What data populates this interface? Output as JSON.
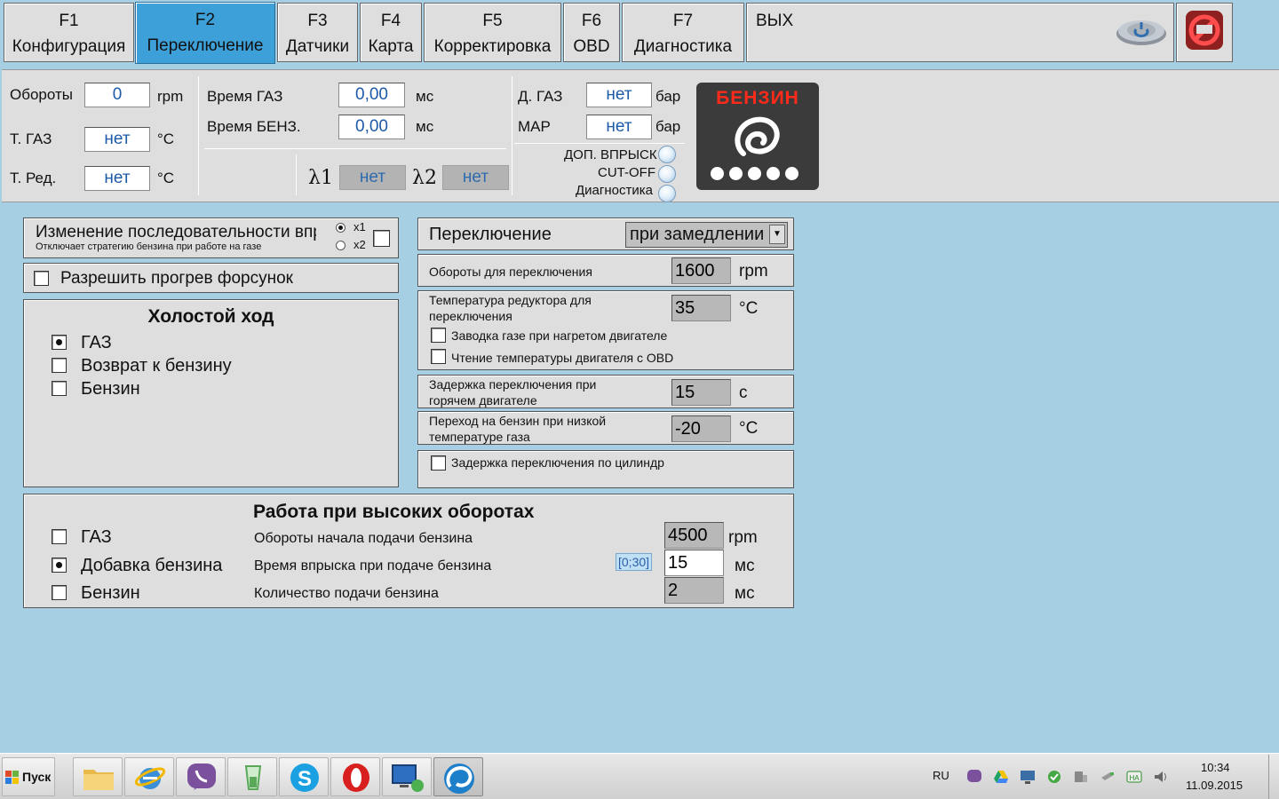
{
  "tabs": [
    {
      "key": "F1",
      "label": "Конфигурация"
    },
    {
      "key": "F2",
      "label": "Переключение"
    },
    {
      "key": "F3",
      "label": "Датчики"
    },
    {
      "key": "F4",
      "label": "Карта"
    },
    {
      "key": "F5",
      "label": "Корректировка"
    },
    {
      "key": "F6",
      "label": "OBD"
    },
    {
      "key": "F7",
      "label": "Диагностика"
    }
  ],
  "exit_label": "ВЫХ",
  "status": {
    "rpm_label": "Обороты",
    "rpm_value": "0",
    "rpm_unit": "rpm",
    "t_gas_label": "Т. ГАЗ",
    "t_gas_value": "нет",
    "t_gas_unit": "°C",
    "t_red_label": "Т. Ред.",
    "t_red_value": "нет",
    "t_red_unit": "°C",
    "time_gas_label": "Время ГАЗ",
    "time_gas_value": "0,00",
    "time_gas_unit": "мс",
    "time_benz_label": "Время БЕНЗ.",
    "time_benz_value": "0,00",
    "time_benz_unit": "мс",
    "lambda1_label": "λ1",
    "lambda1_value": "нет",
    "lambda2_label": "λ2",
    "lambda2_value": "нет",
    "p_gas_label": "Д. ГАЗ",
    "p_gas_value": "нет",
    "p_gas_unit": "бар",
    "map_label": "MAP",
    "map_value": "нет",
    "map_unit": "бар",
    "ind_extra_injection": "ДОП. ВПРЫСК",
    "ind_cutoff": "CUT-OFF",
    "ind_diagnostics": "Диагностика",
    "fuel_badge": "БЕНЗИН"
  },
  "seq_change": {
    "title": "Изменение последовательности впр",
    "subtitle": "Отключает стратегию бензина при работе на газе",
    "x1_label": "x1",
    "x2_label": "x2",
    "selected": "x1"
  },
  "injector_warmup_label": "Разрешить прогрев форсунок",
  "idle": {
    "title": "Холостой ход",
    "options": [
      "ГАЗ",
      "Возврат к бензину",
      "Бензин"
    ],
    "selected": "ГАЗ"
  },
  "switching": {
    "label": "Переключение",
    "mode": "при замедлении",
    "rpm_label": "Обороты для переключения",
    "rpm_value": "1600",
    "rpm_unit": "rpm",
    "temp_label_1": "Температура редуктора для",
    "temp_label_2": "переключения",
    "temp_value": "35",
    "temp_unit": "°C",
    "hot_start_label": "Заводка газе при нагретом двигателе",
    "obd_temp_label": "Чтение температуры двигателя с OBD",
    "delay_label_1": "Задержка переключения при",
    "delay_label_2": "горячем двигателе",
    "delay_value": "15",
    "delay_unit": "с",
    "low_temp_label_1": "Переход на бензин при низкой",
    "low_temp_label_2": "температуре газа",
    "low_temp_value": "-20",
    "low_temp_unit": "°C",
    "cyl_delay_label": "Задержка переключения по цилиндр"
  },
  "high_rpm": {
    "title": "Работа при высоких оборотах",
    "options": [
      "ГАЗ",
      "Добавка бензина",
      "Бензин"
    ],
    "selected": "Добавка бензина",
    "start_rpm_label": "Обороты начала подачи бензина",
    "start_rpm_value": "4500",
    "start_rpm_unit": "rpm",
    "inj_time_label": "Время впрыска при подаче бензина",
    "inj_time_range": "[0;30]",
    "inj_time_value": "15",
    "inj_time_unit": "мс",
    "amount_label": "Количество подачи бензина",
    "amount_value": "2",
    "amount_unit": "мс"
  },
  "taskbar": {
    "start_label": "Пуск",
    "lang": "RU",
    "time": "10:34",
    "date": "11.09.2015"
  }
}
